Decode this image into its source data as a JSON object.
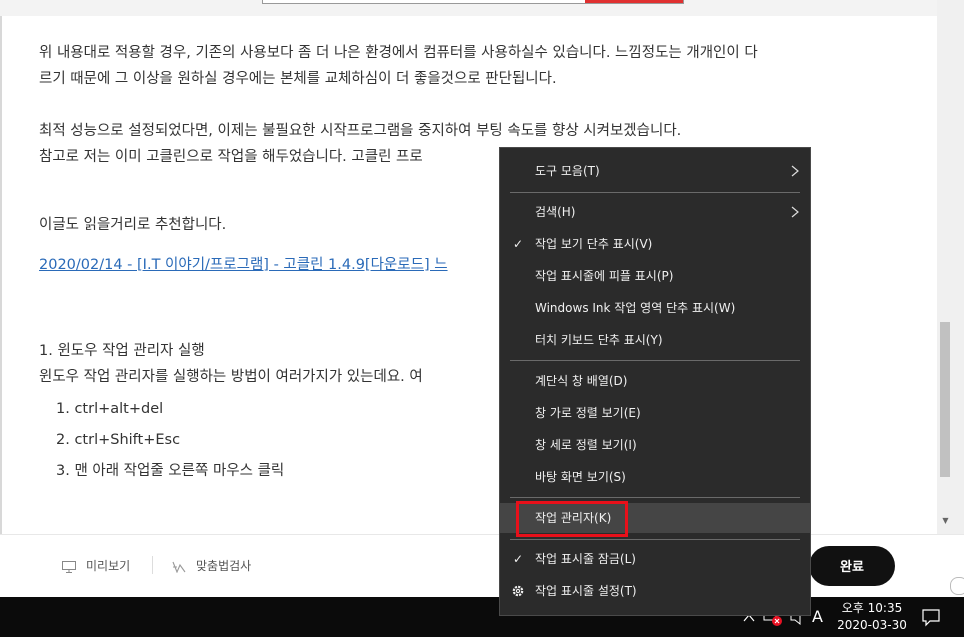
{
  "editor": {
    "p1_line1": "위 내용대로 적용할 경우, 기존의 사용보다 좀 더 나은 환경에서 컴퓨터를 사용하실수 있습니다. 느낌정도는 개개인이 다",
    "p1_line2": "르기 때문에 그 이상을 원하실 경우에는 본체를 교체하심이 더 좋을것으로 판단됩니다.",
    "p2_line1": "최적 성능으로 설정되었다면, 이제는 불필요한 시작프로그램을 중지하여 부팅 속도를 향상 시켜보겠습니다.",
    "p2_line2": "참고로 저는 이미 고클린으로 작업을 해두었습니다. 고클린 프로",
    "p3": "이글도 읽을거리로 추천합니다.",
    "link": "2020/02/14 - [I.T 이야기/프로그램] - 고클린 1.4.9[다운로드] 느",
    "section_title": "1. 윈도우 작업 관리자 실행",
    "section_text": "윈도우 작업 관리자를 실행하는 방법이 여러가지가 있는데요. 여",
    "list": [
      "1. ctrl+alt+del",
      "2. ctrl+Shift+Esc",
      "3. 맨 아래 작업줄 오른쪽 마우스 클릭"
    ]
  },
  "toolbar": {
    "preview_label": "미리보기",
    "spellcheck_label": "맞춤법검사",
    "done_label": "완료"
  },
  "context_menu": {
    "items": [
      {
        "label": "도구 모음(T)",
        "check": "",
        "submenu": true
      },
      {
        "label": "검색(H)",
        "check": "",
        "submenu": true
      },
      {
        "label": "작업 보기 단추 표시(V)",
        "check": "✓",
        "submenu": false
      },
      {
        "label": "작업 표시줄에 피플 표시(P)",
        "check": "",
        "submenu": false
      },
      {
        "label": "Windows Ink 작업 영역 단추 표시(W)",
        "check": "",
        "submenu": false
      },
      {
        "label": "터치 키보드 단추 표시(Y)",
        "check": "",
        "submenu": false
      },
      {
        "label": "계단식 창 배열(D)",
        "check": "",
        "submenu": false
      },
      {
        "label": "창 가로 정렬 보기(E)",
        "check": "",
        "submenu": false
      },
      {
        "label": "창 세로 정렬 보기(I)",
        "check": "",
        "submenu": false
      },
      {
        "label": "바탕 화면 보기(S)",
        "check": "",
        "submenu": false
      },
      {
        "label": "작업 관리자(K)",
        "check": "",
        "submenu": false
      },
      {
        "label": "작업 표시줄 잠금(L)",
        "check": "✓",
        "submenu": false
      },
      {
        "label": "작업 표시줄 설정(T)",
        "check": "gear",
        "submenu": false
      }
    ]
  },
  "taskbar": {
    "ime_label": "A",
    "clock_time": "오후 10:35",
    "clock_date": "2020-03-30"
  },
  "colors": {
    "highlight": "#e8101a",
    "menu_bg": "#2b2b2b",
    "link": "#2a6ab8",
    "done_bg": "#111111"
  }
}
